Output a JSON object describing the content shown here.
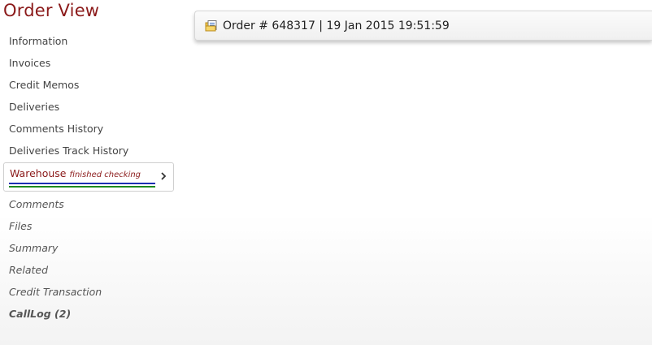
{
  "page": {
    "title": "Order View"
  },
  "header": {
    "order_label": "Order # 648317 | 19 Jan 2015 19:51:59"
  },
  "sidebar": {
    "items": [
      {
        "label": "Information"
      },
      {
        "label": "Invoices"
      },
      {
        "label": "Credit Memos"
      },
      {
        "label": "Deliveries"
      },
      {
        "label": "Comments History"
      },
      {
        "label": "Deliveries Track History"
      }
    ],
    "active": {
      "label": "Warehouse",
      "status": "finished checking"
    },
    "items_after": [
      {
        "label": "Comments"
      },
      {
        "label": "Files"
      },
      {
        "label": "Summary"
      },
      {
        "label": "Related"
      },
      {
        "label": "Credit Transaction"
      },
      {
        "label": "CallLog (2)"
      }
    ]
  },
  "colors": {
    "title": "#8b1a1a",
    "active_bar_primary": "#1c2fb3",
    "active_bar_secondary": "#1d8a1d"
  },
  "icons": {
    "order": "document-folder-icon",
    "expand": "chevron-right-icon"
  }
}
